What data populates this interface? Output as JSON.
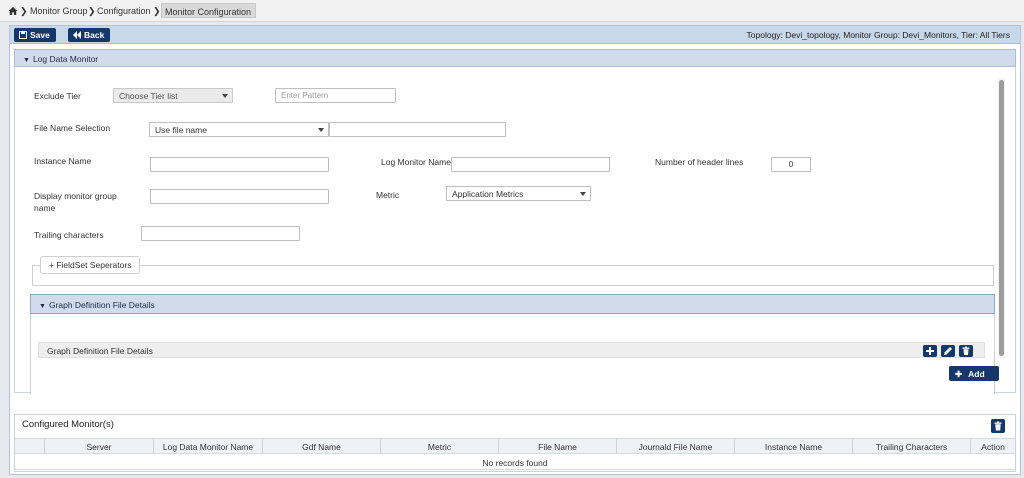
{
  "breadcrumb": {
    "items": [
      "Monitor Group",
      "Configuration"
    ],
    "active": "Monitor Configuration"
  },
  "toolbar": {
    "save_label": "Save",
    "back_label": "Back",
    "info": "Topology: Devi_topology, Monitor Group: Devi_Monitors, Tier: All Tiers"
  },
  "log_section": {
    "title": "Log Data Monitor"
  },
  "form": {
    "exclude_tier_label": "Exclude Tier",
    "exclude_tier_value": "Choose Tier list",
    "pattern_placeholder": "Enter Pattern",
    "file_name_selection_label": "File Name Selection",
    "file_name_selection_value": "Use file name",
    "instance_name_label": "Instance Name",
    "log_monitor_name_label": "Log Monitor Name",
    "header_lines_label": "Number of header lines",
    "header_lines_value": "0",
    "display_group_label": "Display monitor group name",
    "metric_label": "Metric",
    "metric_value": "Application Metrics",
    "trailing_label": "Trailing characters",
    "fieldset_legend": "+ FieldSet Seperators"
  },
  "gdf": {
    "section_title": "Graph Definition File Details",
    "bar_title": "Graph Definition File Details"
  },
  "add_label": "Add",
  "configured": {
    "title": "Configured Monitor(s)",
    "columns": [
      "Server",
      "Log Data Monitor Name",
      "Gdf Name",
      "Metric",
      "File Name",
      "Journald File Name",
      "Instance Name",
      "Trailing Characters",
      "Action"
    ],
    "empty_text": "No records found"
  },
  "colors": {
    "primary_button": "#14386b",
    "section_header": "#d0dcec",
    "toolbar": "#c8d8eb"
  }
}
